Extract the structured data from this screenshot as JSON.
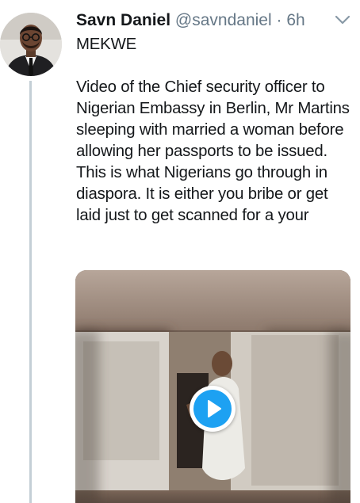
{
  "tweet": {
    "author_name": "Savn Daniel",
    "author_handle": "@savndaniel",
    "separator": "·",
    "timestamp": "6h",
    "text": "MEKWE\n\nVideo of the Chief security officer to Nigerian Embassy in Berlin, Mr Martins sleeping with married a woman before allowing her passports to be issued. This is what Nigerians go through in diaspora. It is either you bribe or get laid just to get scanned for a your"
  },
  "icons": {
    "menu": "chevron-down-icon",
    "play": "play-icon",
    "avatar": "profile-photo"
  },
  "colors": {
    "accent": "#1da1f2",
    "secondary_text": "#657786",
    "thread_line": "#c4cfd6"
  }
}
